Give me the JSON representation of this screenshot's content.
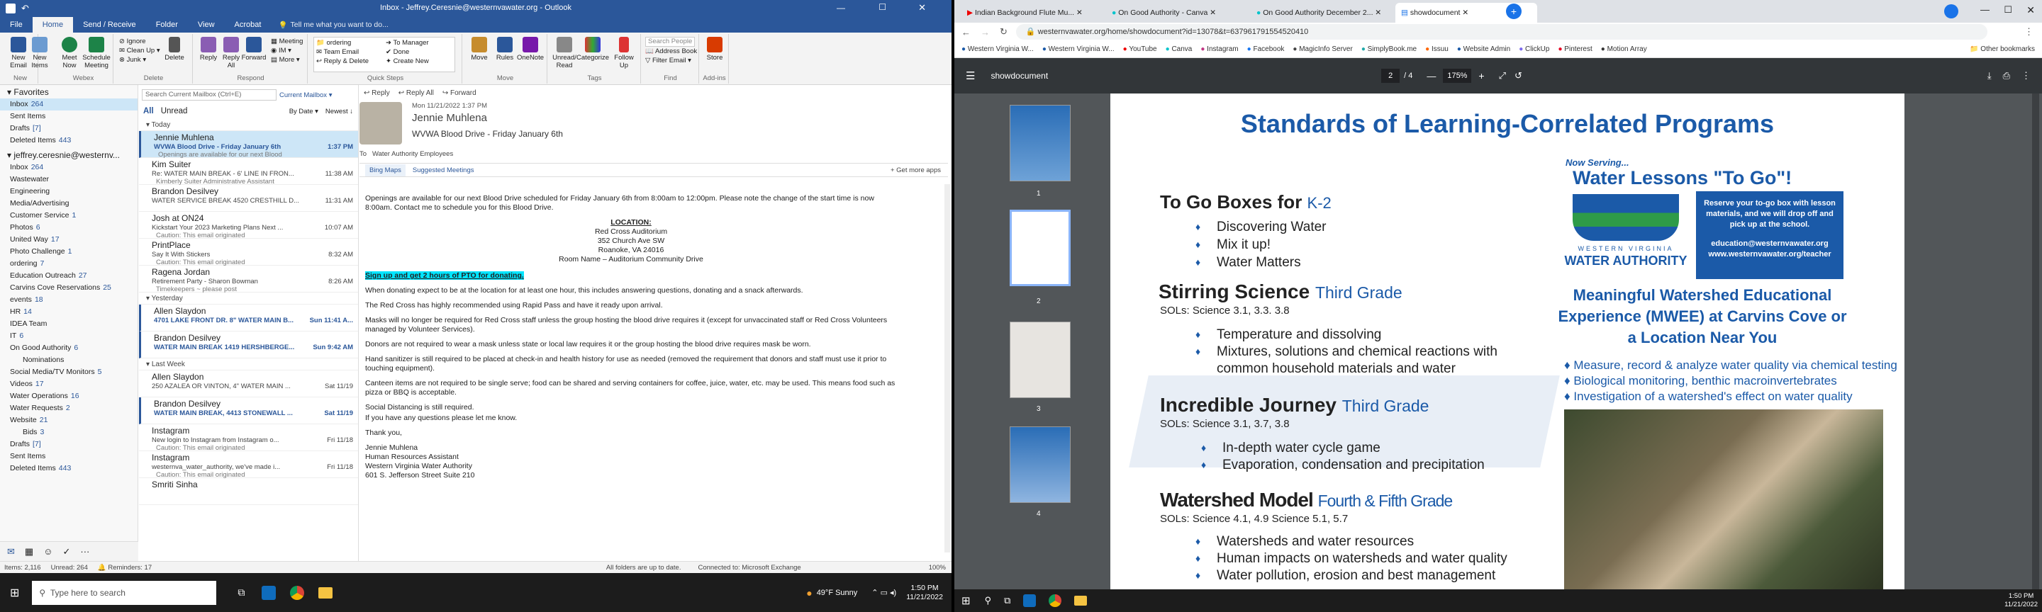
{
  "outlook": {
    "title": "Inbox - Jeffrey.Ceresnie@westernvawater.org - Outlook",
    "tabs": [
      "File",
      "Home",
      "Send / Receive",
      "Folder",
      "View",
      "Acrobat"
    ],
    "tell_me": "Tell me what you want to do...",
    "ribbon": {
      "new_email": "New Email",
      "new_items": "New Items",
      "new_group": "New",
      "ignore": "Ignore",
      "cleanup": "Clean Up",
      "junk": "Junk",
      "delete": "Delete",
      "delete_group": "Delete",
      "reply": "Reply",
      "reply_all": "Reply All",
      "forward": "Forward",
      "meeting": "Meeting",
      "im": "IM",
      "more": "More",
      "respond_group": "Respond",
      "qs_ordering": "ordering",
      "qs_team_email": "Team Email",
      "qs_reply_delete": "Reply & Delete",
      "qs_to_manager": "To Manager",
      "qs_done": "Done",
      "qs_create_new": "Create New",
      "quicksteps_group": "Quick Steps",
      "move": "Move",
      "rules": "Rules",
      "onenote": "OneNote",
      "move_group": "Move",
      "unread_read": "Unread/ Read",
      "categorize": "Categorize",
      "follow_up": "Follow Up",
      "tags_group": "Tags",
      "search_people": "Search People",
      "address_book": "Address Book",
      "filter_email": "Filter Email",
      "find_group": "Find",
      "store": "Store",
      "addins_group": "Add-ins",
      "meet_now": "Meet Now",
      "teams_meeting": "Schedule Meeting",
      "webex_group": "Webex"
    },
    "nav": {
      "favorites": "Favorites",
      "fav_items": [
        {
          "label": "Inbox",
          "count": "264",
          "sel": true
        },
        {
          "label": "Sent Items",
          "count": ""
        },
        {
          "label": "Drafts",
          "count": "[7]"
        },
        {
          "label": "Deleted Items",
          "count": "443"
        }
      ],
      "account": "jeffrey.ceresnie@westernv...",
      "folders": [
        {
          "label": "Inbox",
          "count": "264"
        },
        {
          "label": "Wastewater",
          "count": ""
        },
        {
          "label": "Engineering",
          "count": ""
        },
        {
          "label": "Media/Advertising",
          "count": ""
        },
        {
          "label": "Customer Service",
          "count": "1"
        },
        {
          "label": "Photos",
          "count": "6"
        },
        {
          "label": "United Way",
          "count": "17"
        },
        {
          "label": "Photo Challenge",
          "count": "1"
        },
        {
          "label": "ordering",
          "count": "7"
        },
        {
          "label": "Education Outreach",
          "count": "27"
        },
        {
          "label": "Carvins Cove Reservations",
          "count": "25"
        },
        {
          "label": "events",
          "count": "18"
        },
        {
          "label": "HR",
          "count": "14"
        },
        {
          "label": "IDEA Team",
          "count": ""
        },
        {
          "label": "IT",
          "count": "6"
        },
        {
          "label": "On Good Authority",
          "count": "6"
        },
        {
          "label": "Nominations",
          "count": ""
        },
        {
          "label": "Social Media/TV Monitors",
          "count": "5"
        },
        {
          "label": "Videos",
          "count": "17"
        },
        {
          "label": "Water Operations",
          "count": "16"
        },
        {
          "label": "Water Requests",
          "count": "2"
        },
        {
          "label": "Website",
          "count": "21"
        },
        {
          "label": "Bids",
          "count": "3"
        },
        {
          "label": "Drafts",
          "count": "[7]"
        },
        {
          "label": "Sent Items",
          "count": ""
        },
        {
          "label": "Deleted Items",
          "count": "443"
        }
      ]
    },
    "list": {
      "search_placeholder": "Search Current Mailbox (Ctrl+E)",
      "scope": "Current Mailbox",
      "all": "All",
      "unread": "Unread",
      "sort": "By Date",
      "order": "Newest",
      "groups": {
        "today": "Today",
        "yesterday": "Yesterday",
        "last_week": "Last Week"
      },
      "today_items": [
        {
          "from": "Jennie Muhlena",
          "subject": "WVWA Blood Drive - Friday January 6th",
          "preview": "Openings are available for our next Blood",
          "time": "1:37 PM",
          "sel": true,
          "unread": true
        },
        {
          "from": "Kim Suiter",
          "subject": "Re: WATER MAIN BREAK - 6' LINE IN FRON...",
          "preview": "Kimberly Suiter  Administrative Assistant",
          "time": "11:38 AM"
        },
        {
          "from": "Brandon Desilvey",
          "subject": "WATER SERVICE BREAK 4520 CRESTHILL D...",
          "preview": "",
          "time": "11:31 AM"
        },
        {
          "from": "Josh at ON24",
          "subject": "Kickstart Your 2023 Marketing Plans Next ...",
          "preview": "Caution: This email originated",
          "time": "10:07 AM"
        },
        {
          "from": "PrintPlace",
          "subject": "Say It With Stickers",
          "preview": "Caution: This email originated",
          "time": "8:32 AM"
        },
        {
          "from": "Ragena Jordan",
          "subject": "Retirement Party - Sharon Bowman",
          "preview": "Timekeepers ~ please post",
          "time": "8:26 AM"
        }
      ],
      "yesterday_items": [
        {
          "from": "Allen Slaydon",
          "subject": "4701 LAKE FRONT DR. 8\" WATER MAIN B...",
          "preview": "",
          "time": "Sun 11:41 A...",
          "unread": true
        },
        {
          "from": "Brandon Desilvey",
          "subject": "WATER MAIN BREAK 1419 HERSHBERGE...",
          "preview": "",
          "time": "Sun 9:42 AM",
          "unread": true
        }
      ],
      "lastweek_items": [
        {
          "from": "Allen Slaydon",
          "subject": "250 AZALEA OR VINTON, 4\" WATER MAIN ...",
          "preview": "",
          "time": "Sat 11/19"
        },
        {
          "from": "Brandon Desilvey",
          "subject": "WATER MAIN BREAK, 4413 STONEWALL ...",
          "preview": "",
          "time": "Sat 11/19",
          "unread": true
        },
        {
          "from": "Instagram",
          "subject": "New login to Instagram from Instagram o...",
          "preview": "Caution: This email originated",
          "time": "Fri 11/18"
        },
        {
          "from": "Instagram",
          "subject": "westernva_water_authority, we've made i...",
          "preview": "Caution: This email originated",
          "time": "Fri 11/18"
        },
        {
          "from": "Smriti Sinha",
          "subject": "",
          "preview": "",
          "time": ""
        }
      ]
    },
    "reading": {
      "actions": [
        "Reply",
        "Reply All",
        "Forward"
      ],
      "date": "Mon 11/21/2022 1:37 PM",
      "sender": "Jennie Muhlena",
      "subject": "WVWA Blood Drive - Friday January 6th",
      "to_label": "To",
      "to": "Water Authority Employees",
      "addins": [
        "Bing Maps",
        "Suggested Meetings"
      ],
      "get_more": "+ Get more apps",
      "p1": "Openings are available for our next Blood Drive scheduled for Friday January 6th from 8:00am to 12:00pm.  Please note the change of the start time is now 8:00am.  Contact me to schedule you for this Blood Drive.",
      "loc_head": "LOCATION:",
      "loc1": "Red Cross Auditorium",
      "loc2": "352 Church Ave SW",
      "loc3": "Roanoke, VA  24016",
      "loc4": "Room Name – Auditorium Community Drive",
      "pto": "Sign up and get 2 hours of PTO for donating.",
      "p2": "When donating expect to be at the location for at least one hour, this includes answering questions, donating and a snack afterwards.",
      "p3": "The Red Cross has highly recommended using Rapid Pass and have it ready upon arrival.",
      "p4": "Masks will no longer be required for Red Cross staff unless the group hosting the blood drive requires it (except for unvaccinated staff or Red Cross Volunteers managed by Volunteer Services).",
      "p5": "Donors are not required to wear a mask unless state or local law requires it or the group hosting the blood drive requires mask be worn.",
      "p6": "Hand sanitizer is still required to be placed at check-in and health history for use as needed (removed the requirement that donors and staff must use it prior to touching equipment).",
      "p7": "Canteen items are not required to be single serve; food can be shared and serving containers for coffee, juice, water, etc. may be used. This means food such as pizza or BBQ is acceptable.",
      "p8": "Social Distancing is still required.",
      "p9": "If you have any questions please let me know.",
      "p10": "Thank you,",
      "sig1": "Jennie Muhlena",
      "sig2": "Human Resources Assistant",
      "sig3": "Western Virginia Water Authority",
      "sig4": "601 S. Jefferson Street Suite 210"
    },
    "status": {
      "items": "Items: 2,116",
      "unread": "Unread: 264",
      "reminders": "Reminders: 17",
      "updated": "All folders are up to date.",
      "connected": "Connected to: Microsoft Exchange",
      "zoom": "100%"
    }
  },
  "taskbar1": {
    "search": "Type here to search",
    "weather": "49°F  Sunny",
    "time": "1:50 PM",
    "date": "11/21/2022"
  },
  "chrome": {
    "tabs": [
      {
        "label": "Indian Background Flute Mu..."
      },
      {
        "label": "On Good Authority - Canva"
      },
      {
        "label": "On Good Authority December 2..."
      },
      {
        "label": "showdocument",
        "active": true
      }
    ],
    "url": "westernvawater.org/home/showdocument?id=13078&t=637961791554520410",
    "bookmarks": [
      "Western Virginia W...",
      "Western Virginia W...",
      "YouTube",
      "Canva",
      "Instagram",
      "Facebook",
      "MagicInfo Server",
      "SimplyBook.me",
      "Issuu",
      "Website Admin",
      "ClickUp",
      "Pinterest",
      "Motion Array"
    ],
    "other_bookmarks": "Other bookmarks",
    "pdf": {
      "title": "showdocument",
      "page": "2",
      "pages": "/ 4",
      "zoom": "175%",
      "thumb_labels": [
        "1",
        "2",
        "3",
        "4"
      ],
      "heading": "Standards of Learning-Correlated Programs",
      "togo_head": "To Go Boxes for",
      "togo_grade": "K-2",
      "togo_items": [
        "Discovering Water",
        "Mix it up!",
        "Water Matters"
      ],
      "stir_head": "Stirring Science",
      "stir_grade": "Third Grade",
      "stir_sols": "SOLs: Science 3.1, 3.3. 3.8",
      "stir_items": [
        "Temperature and dissolving",
        "Mixtures, solutions and chemical reactions with",
        "common household materials and water"
      ],
      "journey_head": "Incredible Journey",
      "journey_grade": "Third Grade",
      "journey_sols": "SOLs: Science 3.1, 3.7, 3.8",
      "journey_items": [
        "In-depth water cycle game",
        "Evaporation, condensation and precipitation"
      ],
      "ws_head": "Watershed Model",
      "ws_grade": "Fourth & Fifth Grade",
      "ws_sols": "SOLs: Science 4.1, 4.9  Science 5.1, 5.7",
      "ws_items": [
        "Watersheds and water resources",
        "Human impacts on watersheds and water quality",
        "Water pollution, erosion and best management"
      ],
      "now_serving": "Now Serving...",
      "lessons": "Water Lessons \"To Go\"!",
      "box_text": "Reserve your to-go box with lesson materials, and we will drop off and pick up at the school.",
      "box_email": "education@westernvawater.org",
      "box_url": "www.westernvawater.org/teacher",
      "logo_line1": "WESTERN VIRGINIA",
      "logo_line2": "WATER AUTHORITY",
      "mwee_head": "Meaningful Watershed Educational Experience (MWEE) at Carvins Cove or a Location Near You",
      "mwee_items": [
        "Measure, record & analyze water quality via chemical testing",
        "Biological monitoring, benthic macroinvertebrates",
        "Investigation of a watershed's effect on water quality"
      ]
    }
  },
  "taskbar2": {
    "time": "1:50 PM",
    "date": "11/21/2022"
  }
}
